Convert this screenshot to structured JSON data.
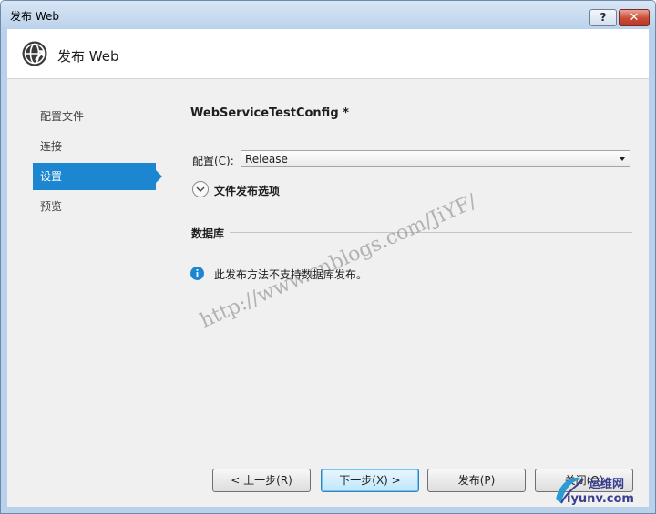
{
  "window": {
    "title": "发布 Web",
    "help_label": "?",
    "close_label": "✕"
  },
  "header": {
    "icon": "globe-arrow-icon",
    "title": "发布 Web"
  },
  "nav": {
    "items": [
      {
        "label": "配置文件"
      },
      {
        "label": "连接"
      },
      {
        "label": "设置"
      },
      {
        "label": "预览"
      }
    ],
    "active": "设置"
  },
  "settings": {
    "profile_name": "WebServiceTestConfig *",
    "config_label": "配置(C):",
    "config_value": "Release",
    "file_publish_options": "文件发布选项",
    "database_section": "数据库",
    "info_message": "此发布方法不支持数据库发布。"
  },
  "watermark": "http://www.cnblogs.com/JiYF/",
  "buttons": {
    "prev": "< 上一步(R)",
    "next": "下一步(X) >",
    "publish": "发布(P)",
    "close": "关闭(O)"
  },
  "corner_logo": {
    "line1": "运维网",
    "line2": "iyunv.com"
  },
  "colors": {
    "accent": "#1c86d1",
    "info": "#1c86d1",
    "close_button": "#c94b35"
  }
}
